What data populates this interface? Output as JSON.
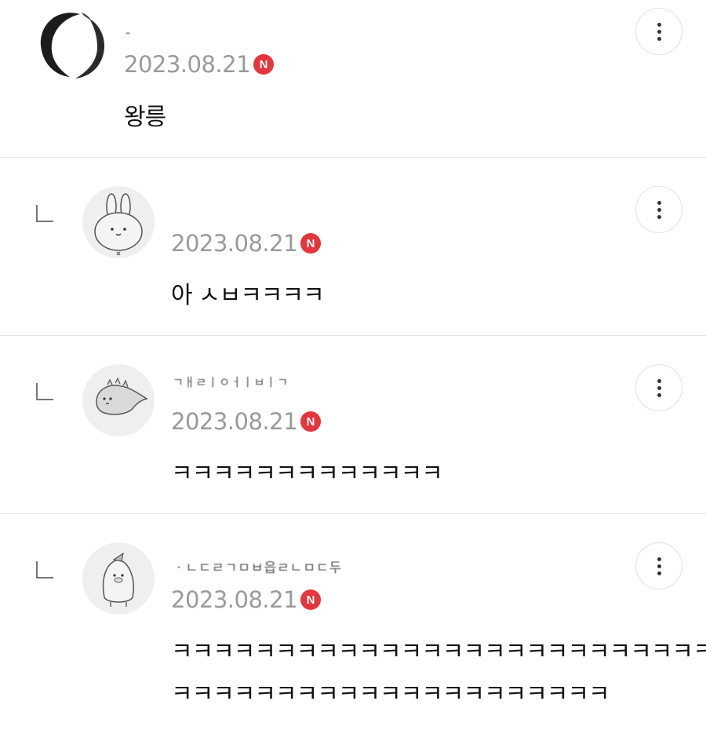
{
  "comments": [
    {
      "author": "-",
      "date": "2023.08.21",
      "badge": "N",
      "lines": [
        "왕릉"
      ],
      "avatar_icon": "profile-photo-icon",
      "is_reply": false
    },
    {
      "author": "",
      "date": "2023.08.21",
      "badge": "N",
      "lines": [
        "아 ㅅㅂㅋㅋㅋㅋ"
      ],
      "avatar_icon": "bunny-avatar-icon",
      "is_reply": true
    },
    {
      "author": "ㄱㅐㄹㅣㅇㅓㅣㅂㅣㄱ",
      "date": "2023.08.21",
      "badge": "N",
      "lines": [
        "ㅋㅋㅋㅋㅋㅋㅋㅋㅋㅋㅋㅋㅋ"
      ],
      "avatar_icon": "dinosaur-avatar-icon",
      "is_reply": true
    },
    {
      "author": "ㆍㄴㄷㄹㄱㅁㅂ읍ㄹㄴㅁㄷ두",
      "date": "2023.08.21",
      "badge": "N",
      "lines": [
        "ㅋㅋㅋㅋㅋㅋㅋㅋㅋㅋㅋㅋㅋㅋㅋㅋㅋㅋㅋㅋㅋㅋㅋㅋㅋㅋ",
        "ㅋㅋㅋㅋㅋㅋㅋㅋㅋㅋㅋㅋㅋㅋㅋㅋㅋㅋㅋㅋㅋ"
      ],
      "avatar_icon": "penguin-avatar-icon",
      "is_reply": true
    }
  ],
  "icons": {
    "more": "more-vertical-icon",
    "reply": "reply-arrow-icon"
  },
  "colors": {
    "badge": "#e3363d",
    "date": "#9a9a9a",
    "divider": "#e4e4e4"
  }
}
